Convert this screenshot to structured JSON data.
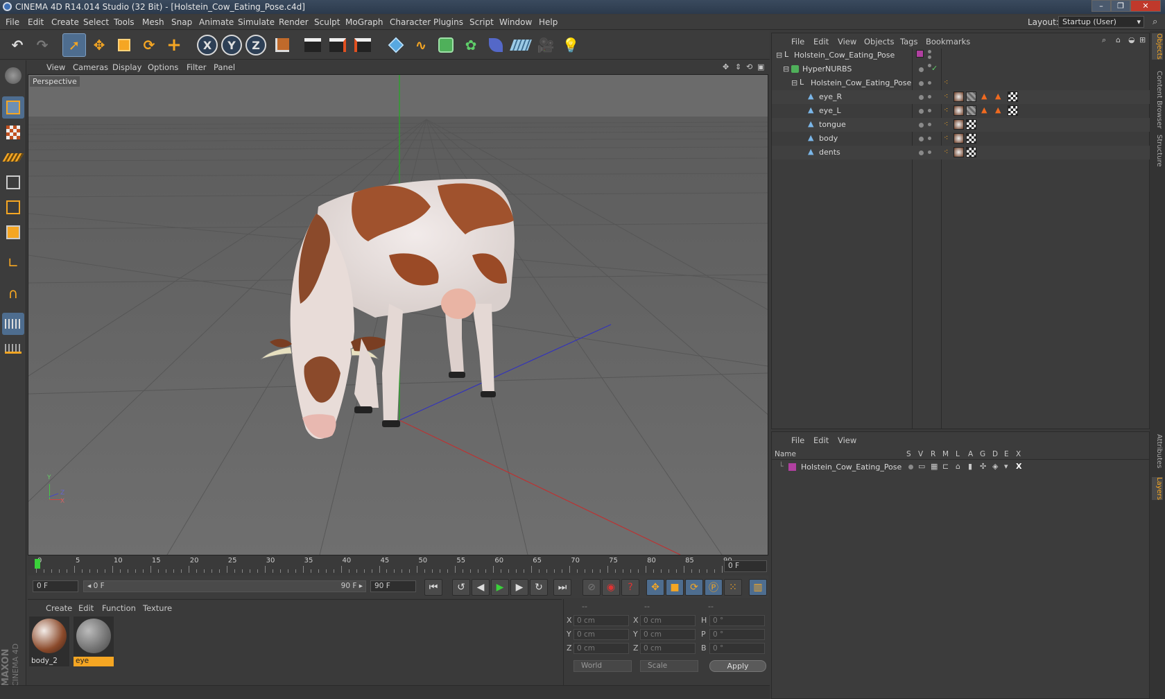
{
  "window": {
    "title": "CINEMA 4D R14.014 Studio (32 Bit) - [Holstein_Cow_Eating_Pose.c4d]",
    "min": "–",
    "max": "❐",
    "close": "✕"
  },
  "menubar": {
    "items": [
      "File",
      "Edit",
      "Create",
      "Select",
      "Tools",
      "Mesh",
      "Snap",
      "Animate",
      "Simulate",
      "Render",
      "Sculpt",
      "MoGraph",
      "Character",
      "Plugins",
      "Script",
      "Window",
      "Help"
    ],
    "layout_label": "Layout:",
    "layout_value": "Startup (User)"
  },
  "toolbar": {
    "axis_x": "X",
    "axis_y": "Y",
    "axis_z": "Z"
  },
  "viewport": {
    "menu": [
      "View",
      "Cameras",
      "Display",
      "Options",
      "Filter",
      "Panel"
    ],
    "label": "Perspective",
    "gizmo": {
      "y": "Y",
      "x": "X",
      "z": "Z"
    }
  },
  "timeline": {
    "ticks": [
      "0",
      "5",
      "10",
      "15",
      "20",
      "25",
      "30",
      "35",
      "40",
      "45",
      "50",
      "55",
      "60",
      "65",
      "70",
      "75",
      "80",
      "85",
      "90"
    ],
    "current_frame": "0 F",
    "start_field": "0 F",
    "range_start": "◂ 0 F",
    "range_end": "90 F ▸",
    "end_field": "90 F"
  },
  "materials": {
    "menu": [
      "Create",
      "Edit",
      "Function",
      "Texture"
    ],
    "items": [
      {
        "name": "body_2",
        "selected": false
      },
      {
        "name": "eye",
        "selected": true
      }
    ]
  },
  "coords": {
    "headers": [
      "--",
      "--",
      "--"
    ],
    "rows": [
      {
        "a": "X",
        "a_val": "0 cm",
        "b": "X",
        "b_val": "0 cm",
        "c": "H",
        "c_val": "0 °"
      },
      {
        "a": "Y",
        "a_val": "0 cm",
        "b": "Y",
        "b_val": "0 cm",
        "c": "P",
        "c_val": "0 °"
      },
      {
        "a": "Z",
        "a_val": "0 cm",
        "b": "Z",
        "b_val": "0 cm",
        "c": "B",
        "c_val": "0 °"
      }
    ],
    "mode": "World",
    "scale": "Scale",
    "apply": "Apply"
  },
  "objects": {
    "menu": [
      "File",
      "Edit",
      "View",
      "Objects",
      "Tags",
      "Bookmarks"
    ],
    "tree": [
      {
        "name": "Holstein_Cow_Eating_Pose",
        "level": 0
      },
      {
        "name": "HyperNURBS",
        "level": 1
      },
      {
        "name": "Holstein_Cow_Eating_Pose",
        "level": 2
      },
      {
        "name": "eye_R",
        "level": 3
      },
      {
        "name": "eye_L",
        "level": 3
      },
      {
        "name": "tongue",
        "level": 3
      },
      {
        "name": "body",
        "level": 3
      },
      {
        "name": "dents",
        "level": 3
      }
    ]
  },
  "layers": {
    "menu": [
      "File",
      "Edit",
      "View"
    ],
    "columns": [
      "Name",
      "S",
      "V",
      "R",
      "M",
      "L",
      "A",
      "G",
      "D",
      "E",
      "X"
    ],
    "rows": [
      {
        "name": "Holstein_Cow_Eating_Pose",
        "color": "#b040a0"
      }
    ]
  },
  "side_tabs": [
    "Objects",
    "Content Browser",
    "Structure",
    "Attributes",
    "Layers"
  ],
  "logo": {
    "line1": "MAXON",
    "line2": "CINEMA 4D"
  },
  "colors": {
    "accent_orange": "#f5a623",
    "selection_blue": "#4e6d8f",
    "layer_magenta": "#b040a0"
  }
}
